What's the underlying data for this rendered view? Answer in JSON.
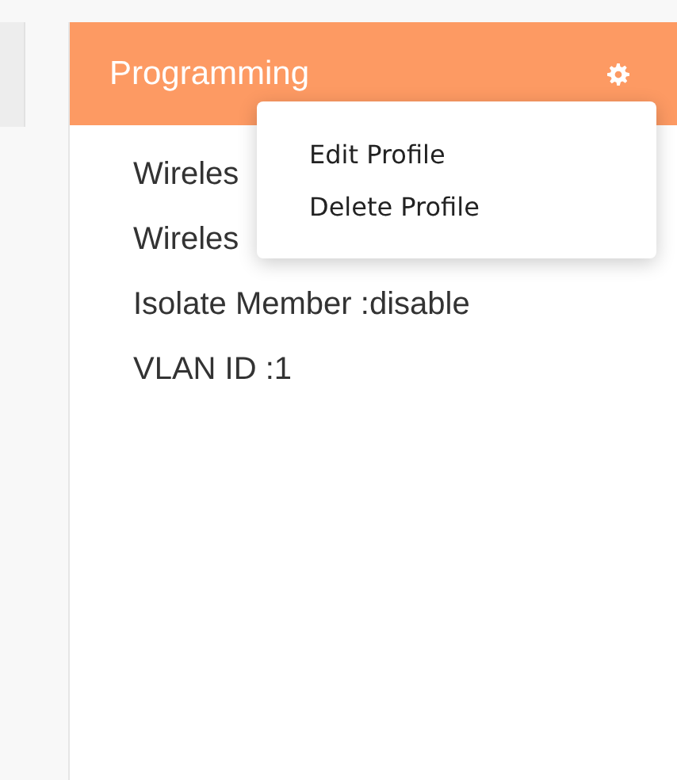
{
  "card": {
    "title": "Programming",
    "lines": [
      "Wireles",
      "Wireles",
      "Isolate Member :disable",
      "VLAN ID :1"
    ]
  },
  "menu": {
    "items": [
      {
        "label": "Edit Profile"
      },
      {
        "label": "Delete Profile"
      }
    ]
  }
}
